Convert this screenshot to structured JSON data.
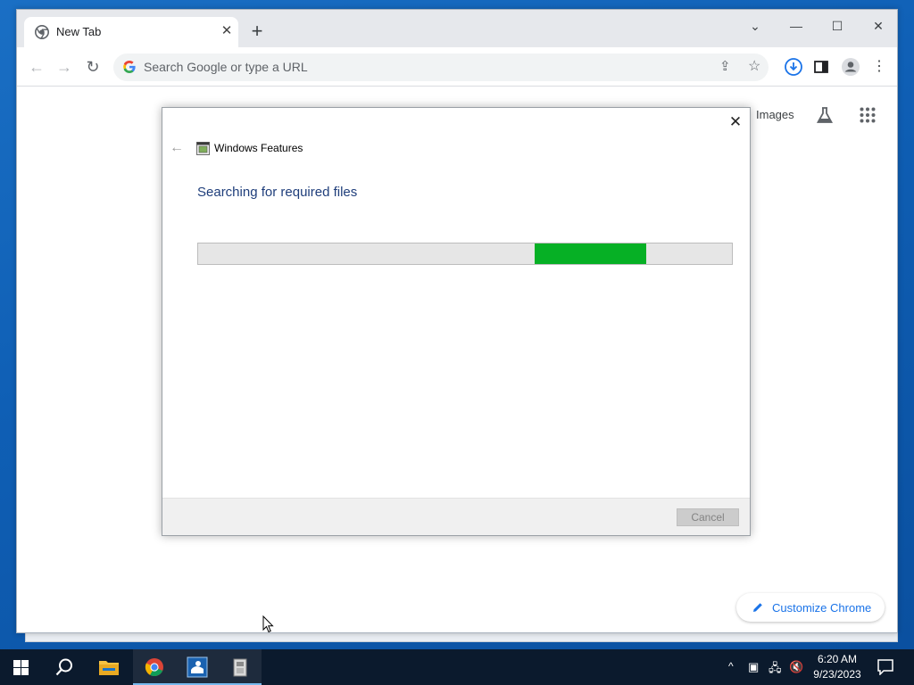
{
  "browser": {
    "tab_title": "New Tab",
    "new_tab_icon": "plus-icon",
    "omnibox_placeholder": "Search Google or type a URL",
    "ntp_images_link": "Images",
    "customize_button": "Customize Chrome",
    "icons": [
      "chrome-logo-icon",
      "back-icon",
      "forward-icon",
      "reload-icon",
      "google-g-icon",
      "share-icon",
      "bookmark-star-icon",
      "download-icon",
      "side-panel-icon",
      "profile-icon",
      "more-menu-icon",
      "labs-flask-icon",
      "apps-grid-icon",
      "pencil-icon"
    ]
  },
  "dialog": {
    "title": "Windows Features",
    "heading": "Searching for required files",
    "progress_chunk_start": 0.63,
    "progress_chunk_end": 0.84,
    "cancel_label": "Cancel",
    "accent_color": "#06b025"
  },
  "taskbar": {
    "time": "6:20 AM",
    "date": "9/23/2023",
    "items": [
      "start-icon",
      "search-icon",
      "file-explorer-icon",
      "chrome-icon",
      "control-panel-icon",
      "installer-icon"
    ]
  }
}
